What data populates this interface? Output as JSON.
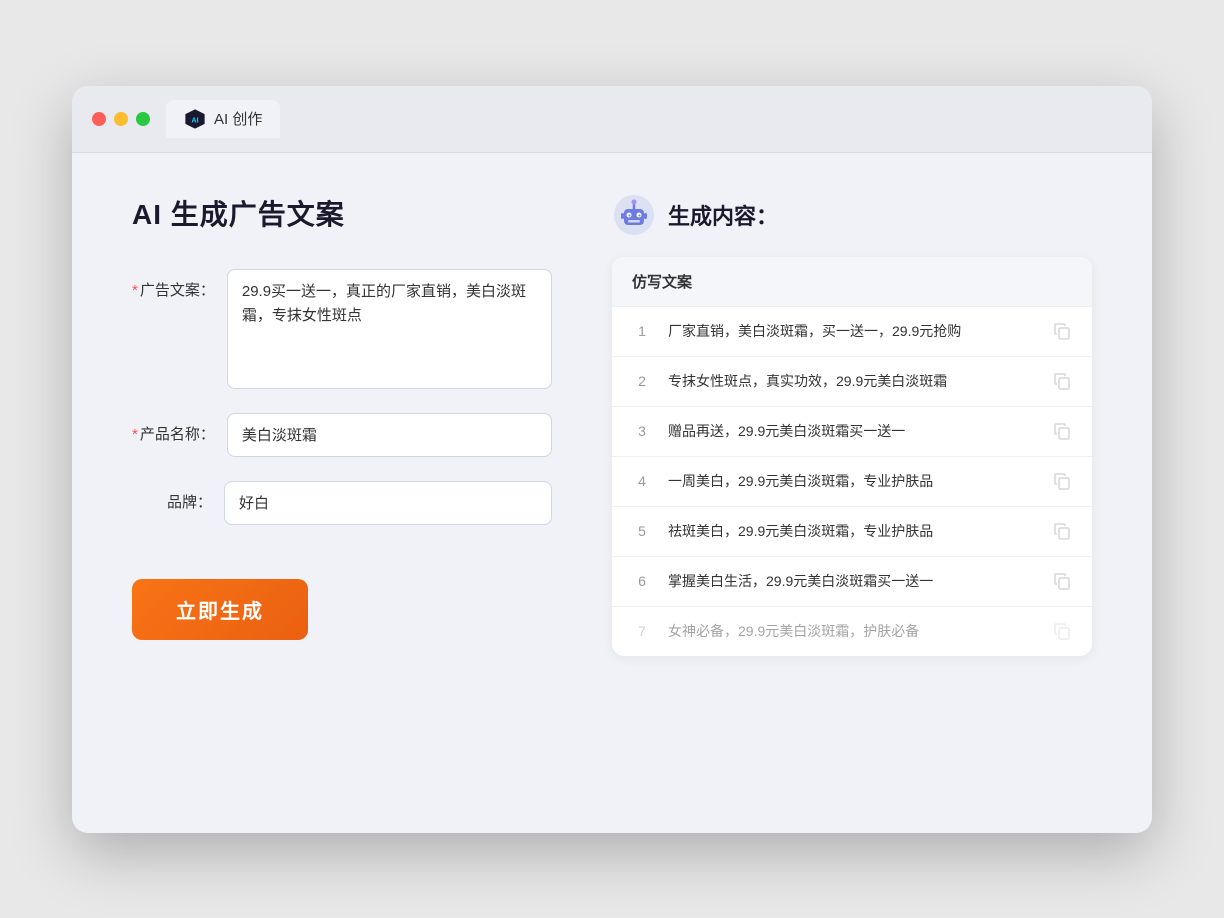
{
  "window": {
    "tab_label": "AI 创作"
  },
  "left": {
    "title": "AI 生成广告文案",
    "fields": [
      {
        "label": "广告文案：",
        "required": true,
        "name": "ad-copy-field",
        "type": "textarea",
        "value": "29.9买一送一，真正的厂家直销，美白淡斑霜，专抹女性斑点"
      },
      {
        "label": "产品名称：",
        "required": true,
        "name": "product-name-field",
        "type": "input",
        "value": "美白淡斑霜"
      },
      {
        "label": "品牌：",
        "required": false,
        "name": "brand-field",
        "type": "input",
        "value": "好白"
      }
    ],
    "button_label": "立即生成"
  },
  "right": {
    "title": "生成内容：",
    "table_header": "仿写文案",
    "results": [
      {
        "num": "1",
        "text": "厂家直销，美白淡斑霜，买一送一，29.9元抢购",
        "dimmed": false
      },
      {
        "num": "2",
        "text": "专抹女性斑点，真实功效，29.9元美白淡斑霜",
        "dimmed": false
      },
      {
        "num": "3",
        "text": "赠品再送，29.9元美白淡斑霜买一送一",
        "dimmed": false
      },
      {
        "num": "4",
        "text": "一周美白，29.9元美白淡斑霜，专业护肤品",
        "dimmed": false
      },
      {
        "num": "5",
        "text": "祛斑美白，29.9元美白淡斑霜，专业护肤品",
        "dimmed": false
      },
      {
        "num": "6",
        "text": "掌握美白生活，29.9元美白淡斑霜买一送一",
        "dimmed": false
      },
      {
        "num": "7",
        "text": "女神必备，29.9元美白淡斑霜，护肤必备",
        "dimmed": true
      }
    ]
  }
}
